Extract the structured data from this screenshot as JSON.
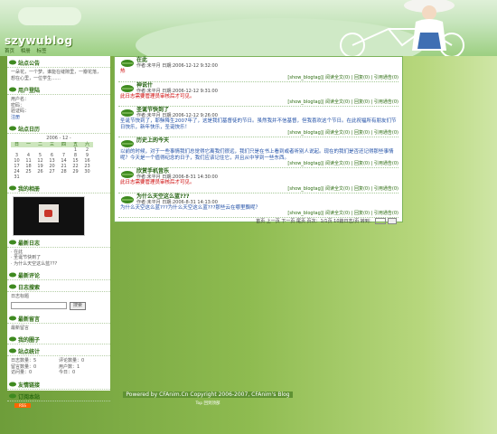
{
  "header": {
    "title": "szywublog",
    "nav": [
      "首页",
      "相册",
      "标签"
    ]
  },
  "sidebar": {
    "notice": {
      "title": "站点公告",
      "lines": [
        "一朵花，一个梦。谁能在缝隙里，一瓣花落，",
        "想在心里，一位学生……"
      ]
    },
    "user": {
      "title": "用户登陆",
      "lines": [
        "用户名：",
        "密码：",
        "验证码：",
        "注册"
      ]
    },
    "calendar": {
      "title": "站点日历",
      "year_month": "2006 - 12 -",
      "weekdays": [
        "日",
        "一",
        "二",
        "三",
        "四",
        "五",
        "六"
      ],
      "weeks": [
        [
          "",
          "",
          "",
          "",
          "",
          "1",
          "2"
        ],
        [
          "3",
          "4",
          "5",
          "6",
          "7",
          "8",
          "9"
        ],
        [
          "10",
          "11",
          "12",
          "13",
          "14",
          "15",
          "16"
        ],
        [
          "17",
          "18",
          "19",
          "20",
          "21",
          "22",
          "23"
        ],
        [
          "24",
          "25",
          "26",
          "27",
          "28",
          "29",
          "30"
        ],
        [
          "31",
          "",
          "",
          "",
          "",
          "",
          ""
        ]
      ]
    },
    "photos": {
      "title": "我的相册"
    },
    "recent": {
      "title": "最新日志",
      "items": [
        "· 在此",
        "· 圣诞节快到了",
        "· 为什么天空这么蓝???"
      ]
    },
    "comments": {
      "title": "最新评论"
    },
    "search": {
      "title": "日志搜索",
      "label": "日志标题",
      "button": "搜索"
    },
    "messages": {
      "title": "最新留言",
      "link": "最新留言"
    },
    "links": {
      "title": "我的圈子"
    },
    "stats": {
      "title": "站点统计",
      "items": [
        "日志数量：5",
        "评论数量：0",
        "留言数量：0",
        "用户数：1",
        "访问量：0",
        "今日：0"
      ]
    },
    "friends": {
      "title": "友情链接"
    },
    "rss": {
      "label": "订阅本站",
      "badge": "RSS"
    }
  },
  "posts": [
    {
      "title": "在此",
      "meta": "作者:未平月 日期:2006-12-12 9:32:00",
      "body": "热",
      "body_color": "red",
      "foot": "[show_blogtag]| 阅读全文(0) | 回复(0) | 引用通告(0)"
    },
    {
      "title": "神说什",
      "meta": "作者:未平月 日期:2006-12-12 9:31:00",
      "body": "此日志需要管理员审核后才可见。",
      "body_color": "red",
      "foot": "[show_blogtag]| 阅读全文(0) | 回复(0) | 引用通告(0)"
    },
    {
      "title": "圣诞节快到了",
      "meta": "作者:未平月 日期:2006-12-12 9:26:00",
      "body": "圣诞节快到了，耶稣降生2007年了，这是我们基督徒的节日。虽然我并不信基督，但我喜欢这个节日。在此祝福所有朋友们节日快乐，新年快乐，圣诞快乐！",
      "body_color": "blue",
      "foot": "[show_blogtag]| 阅读全文(0) | 回复(0) | 引用通告(0)"
    },
    {
      "title": "历史上的今天",
      "meta": "",
      "body": "以前的时候，对于一些事情我们总觉得它离我们很远，我们只是在书上看到或者听别人说起。现在的我们是否还记得那些事情呢？今天是一个值得纪念的日子，我们应该记住它，并且从中学到一些东西。",
      "body_color": "blue",
      "foot": "[show_blogtag]| 阅读全文(0) | 回复(0) | 引用通告(0)"
    },
    {
      "title": "欣赏手机音乐",
      "meta": "作者:未平月 日期:2006-8-31 14:30:00",
      "body": "此日志需要管理员审核后才可见。",
      "body_color": "red",
      "foot": "[show_blogtag]| 阅读全文(0) | 回复(0) | 引用通告(0)"
    },
    {
      "title": "为什么天空这么蓝???",
      "meta": "作者:未平月 日期:2006-8-31 14:13:00",
      "body": "为什么天空这么蓝???为什么天空这么蓝???那些云在哪里飘呢？",
      "body_color": "blue",
      "foot": "[show_blogtag]| 阅读全文(0) | 回复(0) | 引用通告(0)"
    }
  ],
  "pager": {
    "text": "首页 上一页 下一页 尾页 页次：1/1页 10篇日志/页 转到：",
    "go": "GO"
  },
  "footer": {
    "copyright": "Powered by CFAnim.Cn Copyright 2006-2007, CFAnim's Blog",
    "sub": "Top 回到顶部"
  },
  "colors": {
    "leaf": "#3e8a1f",
    "title_green": "#1f5e0b",
    "link_blue": "#1f4ea6",
    "alert_red": "#cc0000"
  }
}
